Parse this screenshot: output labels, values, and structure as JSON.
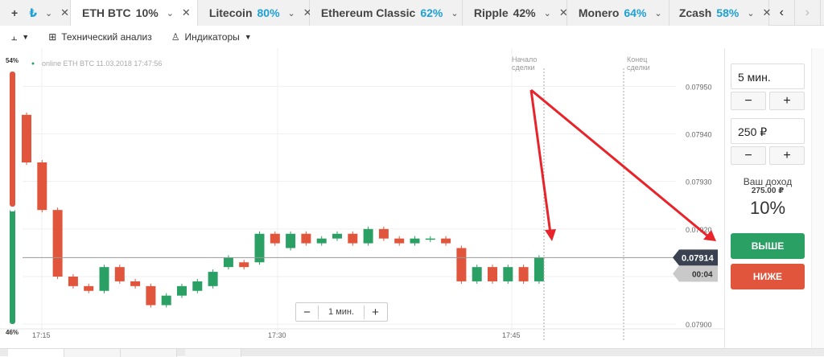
{
  "tabs": {
    "first": {
      "add": "+",
      "currency": "₺"
    },
    "items": [
      {
        "name": "ETH BTC",
        "pct": "10%",
        "pct_color": "#333333",
        "active": true
      },
      {
        "name": "Litecoin",
        "pct": "80%",
        "pct_color": "#1da1d6"
      },
      {
        "name": "Ethereum Classic",
        "pct": "62%",
        "pct_color": "#1da1d6"
      },
      {
        "name": "Ripple",
        "pct": "42%",
        "pct_color": "#333333"
      },
      {
        "name": "Monero",
        "pct": "64%",
        "pct_color": "#1da1d6"
      },
      {
        "name": "Zcash",
        "pct": "58%",
        "pct_color": "#1da1d6"
      }
    ],
    "prev": "‹",
    "next": "›"
  },
  "toolbar": {
    "chart_type_icon": "candle-chart-icon",
    "technical_analysis": "Технический анализ",
    "indicators": "Индикаторы"
  },
  "chart": {
    "status": "online ETH BTC 11.03.2018 17:47:56",
    "start_label": "Начало\nсделки",
    "end_label": "Конец\nсделки",
    "start_label_1": "Начало",
    "start_label_2": "сделки",
    "end_label_1": "Конец",
    "end_label_2": "сделки",
    "sentiment_top": "54%",
    "sentiment_bottom": "46%",
    "current_price": "0.07914",
    "timer": "00:04",
    "zoom_label": "1 мин.",
    "zoom_minus": "−",
    "zoom_plus": "+"
  },
  "chart_data": {
    "type": "candlestick",
    "y_ticks": [
      "0.07950",
      "0.07940",
      "0.07930",
      "0.07920",
      "0.07910",
      "0.07900"
    ],
    "y_tick_values": [
      0.0795,
      0.0794,
      0.0793,
      0.0792,
      0.0791,
      0.079
    ],
    "x_ticks": [
      "17:15",
      "17:30",
      "17:45"
    ],
    "ylim": [
      0.07898,
      0.07958
    ],
    "candles": [
      {
        "o": 0.07944,
        "c": 0.07934,
        "color": "red"
      },
      {
        "o": 0.07934,
        "c": 0.07924,
        "color": "red"
      },
      {
        "o": 0.07924,
        "c": 0.0791,
        "color": "red"
      },
      {
        "o": 0.0791,
        "c": 0.07908,
        "color": "red"
      },
      {
        "o": 0.07907,
        "c": 0.07908,
        "color": "red"
      },
      {
        "o": 0.07907,
        "c": 0.07912,
        "color": "green"
      },
      {
        "o": 0.07912,
        "c": 0.07909,
        "color": "red"
      },
      {
        "o": 0.07909,
        "c": 0.07908,
        "color": "red"
      },
      {
        "o": 0.07908,
        "c": 0.07904,
        "color": "red"
      },
      {
        "o": 0.07904,
        "c": 0.07906,
        "color": "green"
      },
      {
        "o": 0.07906,
        "c": 0.07908,
        "color": "green"
      },
      {
        "o": 0.07907,
        "c": 0.07909,
        "color": "green"
      },
      {
        "o": 0.07908,
        "c": 0.07911,
        "color": "green"
      },
      {
        "o": 0.07912,
        "c": 0.07914,
        "color": "green"
      },
      {
        "o": 0.07913,
        "c": 0.07912,
        "color": "red"
      },
      {
        "o": 0.07913,
        "c": 0.07919,
        "color": "green"
      },
      {
        "o": 0.07919,
        "c": 0.07917,
        "color": "red"
      },
      {
        "o": 0.07916,
        "c": 0.07919,
        "color": "green"
      },
      {
        "o": 0.07919,
        "c": 0.07917,
        "color": "red"
      },
      {
        "o": 0.07917,
        "c": 0.07918,
        "color": "green"
      },
      {
        "o": 0.07918,
        "c": 0.07919,
        "color": "green"
      },
      {
        "o": 0.07919,
        "c": 0.07917,
        "color": "red"
      },
      {
        "o": 0.07917,
        "c": 0.0792,
        "color": "green"
      },
      {
        "o": 0.0792,
        "c": 0.07918,
        "color": "red"
      },
      {
        "o": 0.07918,
        "c": 0.07917,
        "color": "red"
      },
      {
        "o": 0.07917,
        "c": 0.07918,
        "color": "green"
      },
      {
        "o": 0.07918,
        "c": 0.07918,
        "color": "green"
      },
      {
        "o": 0.07918,
        "c": 0.07917,
        "color": "red"
      },
      {
        "o": 0.07916,
        "c": 0.07909,
        "color": "red"
      },
      {
        "o": 0.07909,
        "c": 0.07912,
        "color": "green"
      },
      {
        "o": 0.07912,
        "c": 0.07909,
        "color": "red"
      },
      {
        "o": 0.07909,
        "c": 0.07912,
        "color": "green"
      },
      {
        "o": 0.07912,
        "c": 0.07909,
        "color": "red"
      },
      {
        "o": 0.07909,
        "c": 0.07914,
        "color": "green"
      }
    ],
    "current_price": 0.07914
  },
  "sidebar": {
    "duration": "5 мин.",
    "amount": "250 ₽",
    "minus": "−",
    "plus": "+",
    "income_label": "Ваш доход",
    "income_value": "275.00 ₽",
    "payout_pct": "10%",
    "up_button": "ВЫШЕ",
    "down_button": "НИЖЕ"
  },
  "colors": {
    "green": "#2ba065",
    "red": "#e0553c",
    "arrow": "#e8232a",
    "price_tag": "#3a4150"
  }
}
